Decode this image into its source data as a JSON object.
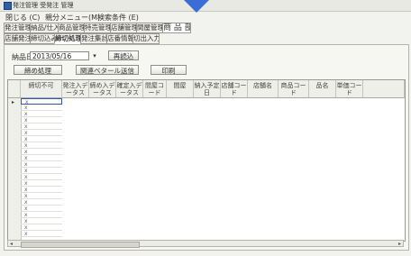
{
  "window": {
    "title": "発注管理 受発注 管理"
  },
  "menu": [
    {
      "label": "閉じる (C)"
    },
    {
      "label": "親分メニュー(M)"
    },
    {
      "label": "検索条件 (E)"
    }
  ],
  "main_tabs": [
    {
      "label": "発注管理"
    },
    {
      "label": "納品/仕入"
    },
    {
      "label": "商品管理"
    },
    {
      "label": "特売管理"
    },
    {
      "label": "店舗管理"
    },
    {
      "label": "間屋管理"
    },
    {
      "label": "商 品 部"
    }
  ],
  "sub_tabs": [
    {
      "label": "店舗発注"
    },
    {
      "label": "締切込み"
    },
    {
      "label": "締切処理"
    },
    {
      "label": "発注集計"
    },
    {
      "label": "店番情報"
    },
    {
      "label": "切出入力"
    }
  ],
  "form": {
    "date_label": "納品日",
    "date_value": "2013/05/16",
    "reload_button": "再読込",
    "confirm_button": "締め処理",
    "send_button": "関連ベタール送信",
    "print_button": "印刷"
  },
  "table": {
    "columns": [
      "締切不可",
      "発注入データス",
      "締め入データス",
      "確定入データス",
      "間屋コード",
      "間屋",
      "納入予定日",
      "店舗コード",
      "店舗名",
      "商品コード",
      "品名",
      "単価コード"
    ],
    "row_marker": "x",
    "row_count": 22
  }
}
